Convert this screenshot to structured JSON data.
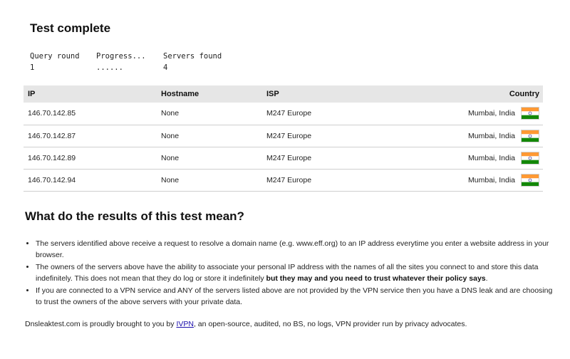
{
  "title": "Test complete",
  "query": {
    "headers": [
      "Query round",
      "Progress...",
      "Servers found"
    ],
    "values": [
      "1",
      "......",
      "4"
    ]
  },
  "table": {
    "headers": {
      "ip": "IP",
      "hostname": "Hostname",
      "isp": "ISP",
      "country": "Country"
    },
    "rows": [
      {
        "ip": "146.70.142.85",
        "hostname": "None",
        "isp": "M247 Europe",
        "country": "Mumbai, India",
        "flag_icon": "india-flag-icon"
      },
      {
        "ip": "146.70.142.87",
        "hostname": "None",
        "isp": "M247 Europe",
        "country": "Mumbai, India",
        "flag_icon": "india-flag-icon"
      },
      {
        "ip": "146.70.142.89",
        "hostname": "None",
        "isp": "M247 Europe",
        "country": "Mumbai, India",
        "flag_icon": "india-flag-icon"
      },
      {
        "ip": "146.70.142.94",
        "hostname": "None",
        "isp": "M247 Europe",
        "country": "Mumbai, India",
        "flag_icon": "india-flag-icon"
      }
    ]
  },
  "explanation": {
    "heading": "What do the results of this test mean?",
    "bullets": [
      {
        "text": "The servers identified above receive a request to resolve a domain name (e.g. www.eff.org) to an IP address everytime you enter a website address in your browser.",
        "bold": ""
      },
      {
        "text": "The owners of the servers above have the ability to associate your personal IP address with the names of all the sites you connect to and store this data indefinitely. This does not mean that they do log or store it indefinitely ",
        "bold": "but they may and you need to trust whatever their policy says",
        "after": "."
      },
      {
        "text": "If you are connected to a VPN service and ANY of the servers listed above are not provided by the VPN service then you have a DNS leak and are choosing to trust the owners of the above servers with your private data.",
        "bold": ""
      }
    ]
  },
  "footer": {
    "before": "Dnsleaktest.com is proudly brought to you by ",
    "link": "IVPN",
    "after": ", an open-source, audited, no BS, no logs, VPN provider run by privacy advocates."
  },
  "colors": {
    "header_bg": "#e6e6e6",
    "link": "#1a0dab",
    "flag_saffron": "#ff9933",
    "flag_white": "#ffffff",
    "flag_green": "#138808",
    "flag_chakra": "#000080"
  }
}
